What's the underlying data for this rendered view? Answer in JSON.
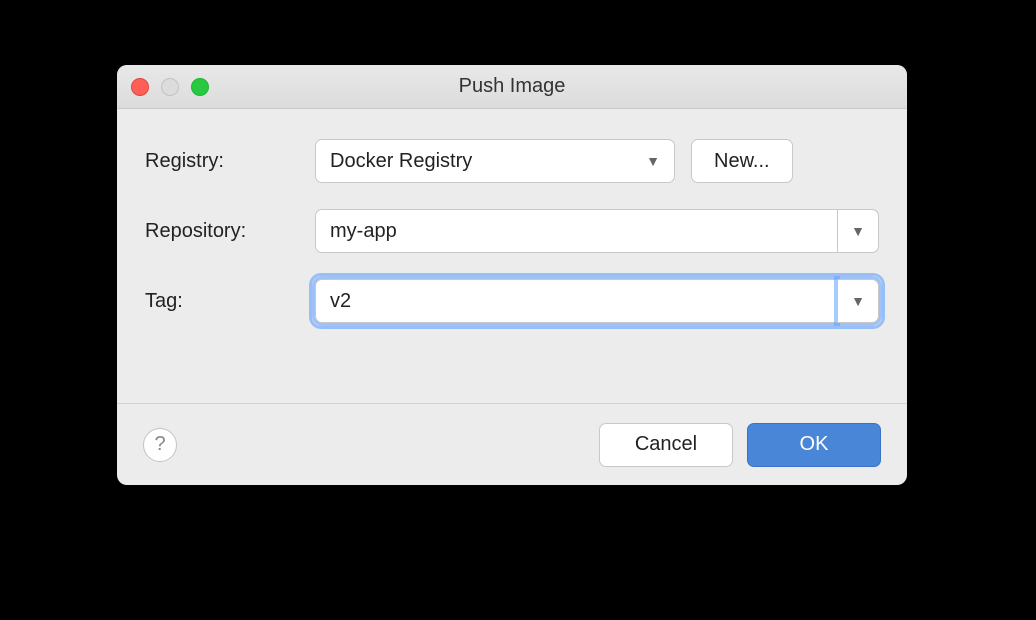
{
  "window": {
    "title": "Push Image"
  },
  "form": {
    "registry": {
      "label": "Registry:",
      "value": "Docker Registry",
      "new_label": "New..."
    },
    "repository": {
      "label": "Repository:",
      "value": "my-app"
    },
    "tag": {
      "label": "Tag:",
      "value": "v2"
    }
  },
  "footer": {
    "help": "?",
    "cancel": "Cancel",
    "ok": "OK"
  }
}
